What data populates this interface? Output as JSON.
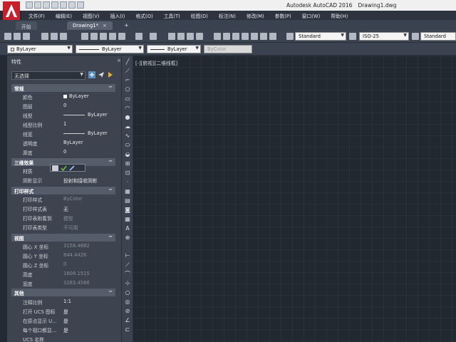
{
  "window": {
    "app_title": "Autodesk AutoCAD 2016",
    "file_title": "Drawing1.dwg"
  },
  "menu": [
    "文件(F)",
    "编辑(E)",
    "视图(V)",
    "插入(I)",
    "格式(O)",
    "工具(T)",
    "绘图(D)",
    "标注(N)",
    "修改(M)",
    "参数(P)",
    "窗口(W)",
    "帮助(H)"
  ],
  "tabs": {
    "start": "开始",
    "drawing": "Drawing1*",
    "close": "×",
    "add": "+"
  },
  "toolbar": {
    "text_style": "Standard",
    "dim_style": "ISO-25",
    "table_style": "Standard",
    "layer": "ByLayer",
    "linetype": "ByLayer",
    "lineweight": "ByLayer",
    "plotstyle": "ByColor"
  },
  "palette": {
    "title": "特性",
    "close": "×",
    "selection": "无选择",
    "sections": [
      {
        "label": "常规",
        "collapse": "−"
      },
      {
        "label": "三维效果",
        "collapse": "−"
      },
      {
        "label": "打印样式",
        "collapse": "−"
      },
      {
        "label": "视图",
        "collapse": "−"
      },
      {
        "label": "其他",
        "collapse": "−"
      }
    ],
    "general": [
      {
        "key": "颜色",
        "value": "ByLayer"
      },
      {
        "key": "图层",
        "value": "0"
      },
      {
        "key": "线型",
        "value": "ByLayer"
      },
      {
        "key": "线型比例",
        "value": "1"
      },
      {
        "key": "线宽",
        "value": "ByLayer"
      },
      {
        "key": "透明度",
        "value": "ByLayer"
      },
      {
        "key": "厚度",
        "value": "0"
      }
    ],
    "effects3d": [
      {
        "key": "材质",
        "value": ""
      },
      {
        "key": "阴影显示",
        "value": "投射和接收阴影"
      }
    ],
    "plot": [
      {
        "key": "打印样式",
        "value": "ByColor"
      },
      {
        "key": "打印样式表",
        "value": "无"
      },
      {
        "key": "打印表附着到",
        "value": "模型"
      },
      {
        "key": "打印表类型",
        "value": "不可用"
      }
    ],
    "view": [
      {
        "key": "圆心 X 坐标",
        "value": "3158.4882"
      },
      {
        "key": "圆心 Y 坐标",
        "value": "844.4426"
      },
      {
        "key": "圆心 Z 坐标",
        "value": "0"
      },
      {
        "key": "高度",
        "value": "1608.1515"
      },
      {
        "key": "宽度",
        "value": "3283.4566"
      }
    ],
    "misc": [
      {
        "key": "注释比例",
        "value": "1:1"
      },
      {
        "key": "打开 UCS 图标",
        "value": "是"
      },
      {
        "key": "在原点显示 U...",
        "value": "是"
      },
      {
        "key": "每个视口都显...",
        "value": "是"
      },
      {
        "key": "UCS 名称",
        "value": ""
      }
    ]
  },
  "canvas": {
    "view_label": "[-][俯视][二维线框]"
  },
  "colors": {
    "canvas_bg": "#212830",
    "panel_bg": "#3d4450",
    "logo_red": "#c8202a"
  }
}
